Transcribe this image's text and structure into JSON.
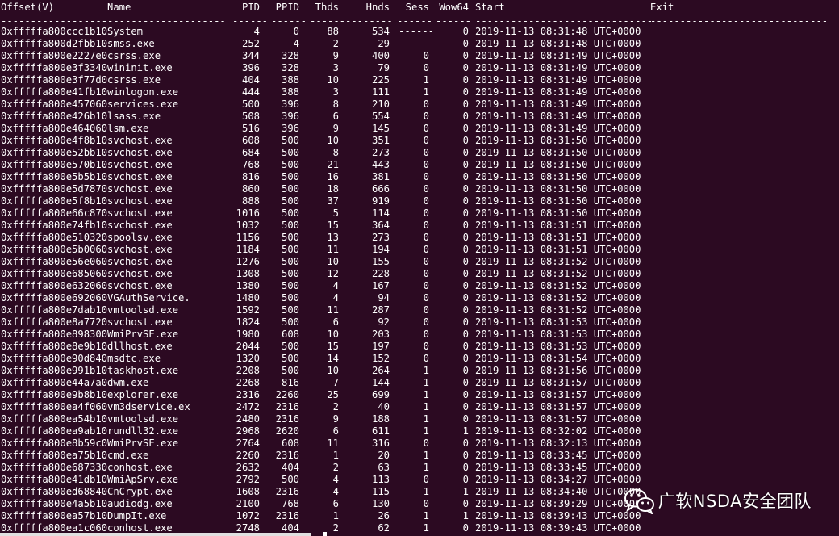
{
  "header": {
    "offset": "Offset(V)",
    "name": "Name",
    "pid": "PID",
    "ppid": "PPID",
    "thds": "Thds",
    "hnds": "Hnds",
    "sess": "Sess",
    "wow64": "Wow64",
    "start": "Start",
    "exit": "Exit"
  },
  "separator": {
    "offset": "------------------",
    "name": "--------------------",
    "pid": "------",
    "ppid": "------",
    "thds": "------",
    "hnds": "--------",
    "sess": "------",
    "wow64": "------",
    "start": "------------------------------",
    "exit": "------------------------------"
  },
  "rows": [
    {
      "offset": "0xfffffa800ccc1b10",
      "name": "System",
      "pid": "4",
      "ppid": "0",
      "thds": "88",
      "hnds": "534",
      "sess": "------",
      "wow64": "0",
      "start": "2019-11-13 08:31:48 UTC+0000"
    },
    {
      "offset": "0xfffffa800d2fbb10",
      "name": "smss.exe",
      "pid": "252",
      "ppid": "4",
      "thds": "2",
      "hnds": "29",
      "sess": "------",
      "wow64": "0",
      "start": "2019-11-13 08:31:48 UTC+0000"
    },
    {
      "offset": "0xfffffa800e2227e0",
      "name": "csrss.exe",
      "pid": "344",
      "ppid": "328",
      "thds": "9",
      "hnds": "400",
      "sess": "0",
      "wow64": "0",
      "start": "2019-11-13 08:31:49 UTC+0000"
    },
    {
      "offset": "0xfffffa800e3f3340",
      "name": "wininit.exe",
      "pid": "396",
      "ppid": "328",
      "thds": "3",
      "hnds": "79",
      "sess": "0",
      "wow64": "0",
      "start": "2019-11-13 08:31:49 UTC+0000"
    },
    {
      "offset": "0xfffffa800e3f77d0",
      "name": "csrss.exe",
      "pid": "404",
      "ppid": "388",
      "thds": "10",
      "hnds": "225",
      "sess": "1",
      "wow64": "0",
      "start": "2019-11-13 08:31:49 UTC+0000"
    },
    {
      "offset": "0xfffffa800e41fb10",
      "name": "winlogon.exe",
      "pid": "444",
      "ppid": "388",
      "thds": "3",
      "hnds": "111",
      "sess": "1",
      "wow64": "0",
      "start": "2019-11-13 08:31:49 UTC+0000"
    },
    {
      "offset": "0xfffffa800e457060",
      "name": "services.exe",
      "pid": "500",
      "ppid": "396",
      "thds": "8",
      "hnds": "210",
      "sess": "0",
      "wow64": "0",
      "start": "2019-11-13 08:31:49 UTC+0000"
    },
    {
      "offset": "0xfffffa800e426b10",
      "name": "lsass.exe",
      "pid": "508",
      "ppid": "396",
      "thds": "6",
      "hnds": "554",
      "sess": "0",
      "wow64": "0",
      "start": "2019-11-13 08:31:49 UTC+0000"
    },
    {
      "offset": "0xfffffa800e464060",
      "name": "lsm.exe",
      "pid": "516",
      "ppid": "396",
      "thds": "9",
      "hnds": "145",
      "sess": "0",
      "wow64": "0",
      "start": "2019-11-13 08:31:49 UTC+0000"
    },
    {
      "offset": "0xfffffa800e4f8b10",
      "name": "svchost.exe",
      "pid": "608",
      "ppid": "500",
      "thds": "10",
      "hnds": "351",
      "sess": "0",
      "wow64": "0",
      "start": "2019-11-13 08:31:50 UTC+0000"
    },
    {
      "offset": "0xfffffa800e52bb10",
      "name": "svchost.exe",
      "pid": "684",
      "ppid": "500",
      "thds": "8",
      "hnds": "273",
      "sess": "0",
      "wow64": "0",
      "start": "2019-11-13 08:31:50 UTC+0000"
    },
    {
      "offset": "0xfffffa800e570b10",
      "name": "svchost.exe",
      "pid": "768",
      "ppid": "500",
      "thds": "21",
      "hnds": "443",
      "sess": "0",
      "wow64": "0",
      "start": "2019-11-13 08:31:50 UTC+0000"
    },
    {
      "offset": "0xfffffa800e5b5b10",
      "name": "svchost.exe",
      "pid": "816",
      "ppid": "500",
      "thds": "16",
      "hnds": "381",
      "sess": "0",
      "wow64": "0",
      "start": "2019-11-13 08:31:50 UTC+0000"
    },
    {
      "offset": "0xfffffa800e5d7870",
      "name": "svchost.exe",
      "pid": "860",
      "ppid": "500",
      "thds": "18",
      "hnds": "666",
      "sess": "0",
      "wow64": "0",
      "start": "2019-11-13 08:31:50 UTC+0000"
    },
    {
      "offset": "0xfffffa800e5f8b10",
      "name": "svchost.exe",
      "pid": "888",
      "ppid": "500",
      "thds": "37",
      "hnds": "919",
      "sess": "0",
      "wow64": "0",
      "start": "2019-11-13 08:31:50 UTC+0000"
    },
    {
      "offset": "0xfffffa800e66c870",
      "name": "svchost.exe",
      "pid": "1016",
      "ppid": "500",
      "thds": "5",
      "hnds": "114",
      "sess": "0",
      "wow64": "0",
      "start": "2019-11-13 08:31:50 UTC+0000"
    },
    {
      "offset": "0xfffffa800e74fb10",
      "name": "svchost.exe",
      "pid": "1032",
      "ppid": "500",
      "thds": "15",
      "hnds": "364",
      "sess": "0",
      "wow64": "0",
      "start": "2019-11-13 08:31:51 UTC+0000"
    },
    {
      "offset": "0xfffffa800e510320",
      "name": "spoolsv.exe",
      "pid": "1156",
      "ppid": "500",
      "thds": "13",
      "hnds": "273",
      "sess": "0",
      "wow64": "0",
      "start": "2019-11-13 08:31:51 UTC+0000"
    },
    {
      "offset": "0xfffffa800e5b0060",
      "name": "svchost.exe",
      "pid": "1184",
      "ppid": "500",
      "thds": "11",
      "hnds": "194",
      "sess": "0",
      "wow64": "0",
      "start": "2019-11-13 08:31:51 UTC+0000"
    },
    {
      "offset": "0xfffffa800e56e060",
      "name": "svchost.exe",
      "pid": "1276",
      "ppid": "500",
      "thds": "10",
      "hnds": "155",
      "sess": "0",
      "wow64": "0",
      "start": "2019-11-13 08:31:52 UTC+0000"
    },
    {
      "offset": "0xfffffa800e685060",
      "name": "svchost.exe",
      "pid": "1308",
      "ppid": "500",
      "thds": "12",
      "hnds": "228",
      "sess": "0",
      "wow64": "0",
      "start": "2019-11-13 08:31:52 UTC+0000"
    },
    {
      "offset": "0xfffffa800e632060",
      "name": "svchost.exe",
      "pid": "1380",
      "ppid": "500",
      "thds": "4",
      "hnds": "167",
      "sess": "0",
      "wow64": "0",
      "start": "2019-11-13 08:31:52 UTC+0000"
    },
    {
      "offset": "0xfffffa800e692060",
      "name": "VGAuthService.",
      "pid": "1480",
      "ppid": "500",
      "thds": "4",
      "hnds": "94",
      "sess": "0",
      "wow64": "0",
      "start": "2019-11-13 08:31:52 UTC+0000"
    },
    {
      "offset": "0xfffffa800e7dab10",
      "name": "vmtoolsd.exe",
      "pid": "1592",
      "ppid": "500",
      "thds": "11",
      "hnds": "287",
      "sess": "0",
      "wow64": "0",
      "start": "2019-11-13 08:31:52 UTC+0000"
    },
    {
      "offset": "0xfffffa800e8a7720",
      "name": "svchost.exe",
      "pid": "1824",
      "ppid": "500",
      "thds": "6",
      "hnds": "92",
      "sess": "0",
      "wow64": "0",
      "start": "2019-11-13 08:31:53 UTC+0000"
    },
    {
      "offset": "0xfffffa800e898300",
      "name": "WmiPrvSE.exe",
      "pid": "1980",
      "ppid": "608",
      "thds": "10",
      "hnds": "203",
      "sess": "0",
      "wow64": "0",
      "start": "2019-11-13 08:31:53 UTC+0000"
    },
    {
      "offset": "0xfffffa800e8e9b10",
      "name": "dllhost.exe",
      "pid": "2044",
      "ppid": "500",
      "thds": "15",
      "hnds": "197",
      "sess": "0",
      "wow64": "0",
      "start": "2019-11-13 08:31:53 UTC+0000"
    },
    {
      "offset": "0xfffffa800e90d840",
      "name": "msdtc.exe",
      "pid": "1320",
      "ppid": "500",
      "thds": "14",
      "hnds": "152",
      "sess": "0",
      "wow64": "0",
      "start": "2019-11-13 08:31:54 UTC+0000"
    },
    {
      "offset": "0xfffffa800e991b10",
      "name": "taskhost.exe",
      "pid": "2208",
      "ppid": "500",
      "thds": "10",
      "hnds": "264",
      "sess": "1",
      "wow64": "0",
      "start": "2019-11-13 08:31:56 UTC+0000"
    },
    {
      "offset": "0xfffffa800e44a7a0",
      "name": "dwm.exe",
      "pid": "2268",
      "ppid": "816",
      "thds": "7",
      "hnds": "144",
      "sess": "1",
      "wow64": "0",
      "start": "2019-11-13 08:31:57 UTC+0000"
    },
    {
      "offset": "0xfffffa800e9b8b10",
      "name": "explorer.exe",
      "pid": "2316",
      "ppid": "2260",
      "thds": "25",
      "hnds": "699",
      "sess": "1",
      "wow64": "0",
      "start": "2019-11-13 08:31:57 UTC+0000"
    },
    {
      "offset": "0xfffffa800ea4f060",
      "name": "vm3dservice.ex",
      "pid": "2472",
      "ppid": "2316",
      "thds": "2",
      "hnds": "40",
      "sess": "1",
      "wow64": "0",
      "start": "2019-11-13 08:31:57 UTC+0000"
    },
    {
      "offset": "0xfffffa800ea54b10",
      "name": "vmtoolsd.exe",
      "pid": "2480",
      "ppid": "2316",
      "thds": "9",
      "hnds": "188",
      "sess": "1",
      "wow64": "0",
      "start": "2019-11-13 08:31:57 UTC+0000"
    },
    {
      "offset": "0xfffffa800ea9ab10",
      "name": "rundll32.exe",
      "pid": "2968",
      "ppid": "2620",
      "thds": "6",
      "hnds": "611",
      "sess": "1",
      "wow64": "1",
      "start": "2019-11-13 08:32:02 UTC+0000"
    },
    {
      "offset": "0xfffffa800e8b59c0",
      "name": "WmiPrvSE.exe",
      "pid": "2764",
      "ppid": "608",
      "thds": "11",
      "hnds": "316",
      "sess": "0",
      "wow64": "0",
      "start": "2019-11-13 08:32:13 UTC+0000"
    },
    {
      "offset": "0xfffffa800ea75b10",
      "name": "cmd.exe",
      "pid": "2260",
      "ppid": "2316",
      "thds": "1",
      "hnds": "20",
      "sess": "1",
      "wow64": "0",
      "start": "2019-11-13 08:33:45 UTC+0000"
    },
    {
      "offset": "0xfffffa800e687330",
      "name": "conhost.exe",
      "pid": "2632",
      "ppid": "404",
      "thds": "2",
      "hnds": "63",
      "sess": "1",
      "wow64": "0",
      "start": "2019-11-13 08:33:45 UTC+0000"
    },
    {
      "offset": "0xfffffa800e41db10",
      "name": "WmiApSrv.exe",
      "pid": "2792",
      "ppid": "500",
      "thds": "4",
      "hnds": "113",
      "sess": "0",
      "wow64": "0",
      "start": "2019-11-13 08:34:27 UTC+0000"
    },
    {
      "offset": "0xfffffa800ed68840",
      "name": "CnCrypt.exe",
      "pid": "1608",
      "ppid": "2316",
      "thds": "4",
      "hnds": "115",
      "sess": "1",
      "wow64": "1",
      "start": "2019-11-13 08:34:40 UTC+0000"
    },
    {
      "offset": "0xfffffa800e4a5b10",
      "name": "audiodg.exe",
      "pid": "2100",
      "ppid": "768",
      "thds": "6",
      "hnds": "130",
      "sess": "0",
      "wow64": "0",
      "start": "2019-11-13 08:39:29 UTC+0000"
    },
    {
      "offset": "0xfffffa800ea57b10",
      "name": "DumpIt.exe",
      "pid": "1072",
      "ppid": "2316",
      "thds": "1",
      "hnds": "26",
      "sess": "1",
      "wow64": "1",
      "start": "2019-11-13 08:39:43 UTC+0000"
    },
    {
      "offset": "0xfffffa800ea1c060",
      "name": "conhost.exe",
      "pid": "2748",
      "ppid": "404",
      "thds": "2",
      "hnds": "62",
      "sess": "1",
      "wow64": "0",
      "start": "2019-11-13 08:39:43 UTC+0000"
    }
  ],
  "watermark": {
    "text": "广软NSDA安全团队",
    "icon": "wechat-icon"
  },
  "colors": {
    "background": "#2c0a22",
    "text": "#ffffff"
  }
}
